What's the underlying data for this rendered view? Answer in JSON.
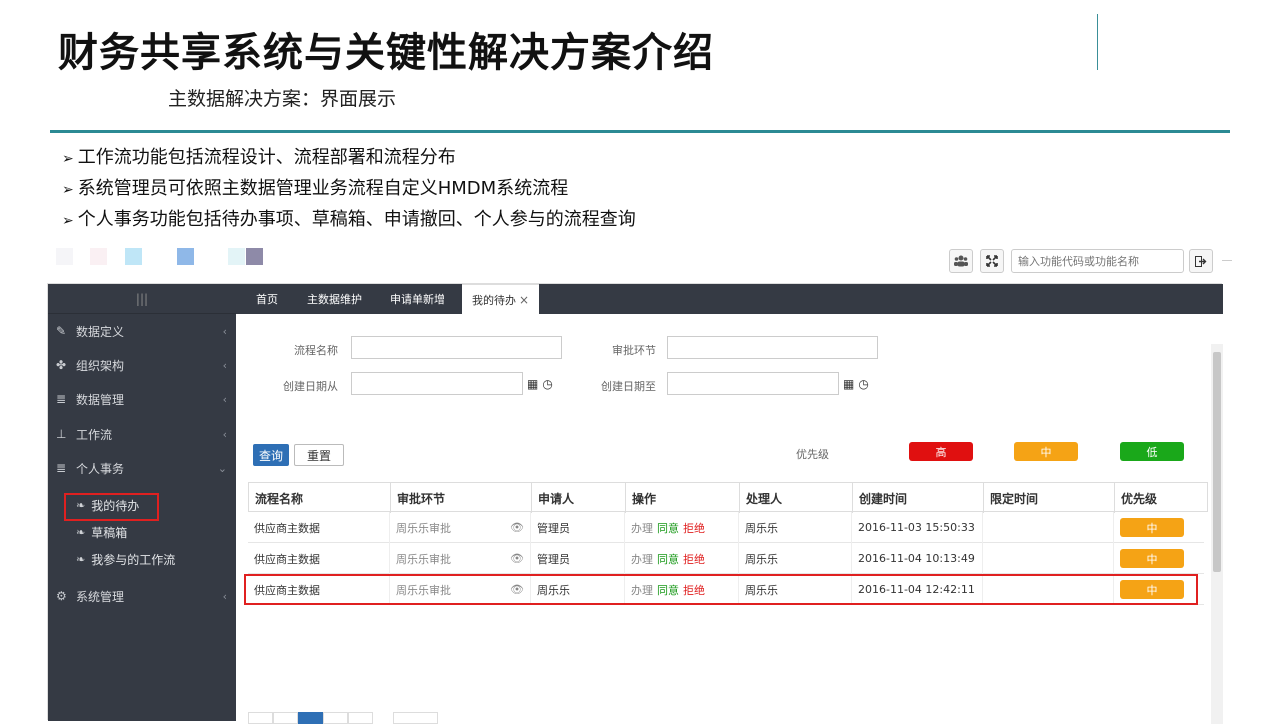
{
  "slide": {
    "title": "财务共享系统与关键性解决方案介绍",
    "subtitle": "主数据解决方案：界面展示",
    "bullets": [
      "工作流功能包括流程设计、流程部署和流程分布",
      "系统管理员可依照主数据管理业务流程自定义HMDM系统流程",
      "个人事务功能包括待办事项、草稿箱、申请撤回、个人参与的流程查询"
    ],
    "bullet_marker": "➢"
  },
  "swatches": [
    "#f5f5f8",
    "#faf0f3",
    "#bfe6f7",
    "#8fb8e8",
    "#e3f4f7",
    "#8e8aa8"
  ],
  "toolbar": {
    "search_placeholder": "输入功能代码或功能名称"
  },
  "sidebar": {
    "items": [
      {
        "label": "数据定义",
        "icon": "pencil-icon"
      },
      {
        "label": "组织架构",
        "icon": "org-icon"
      },
      {
        "label": "数据管理",
        "icon": "database-icon"
      },
      {
        "label": "工作流",
        "icon": "sitemap-icon"
      },
      {
        "label": "个人事务",
        "icon": "database-icon"
      },
      {
        "label": "系统管理",
        "icon": "gears-icon"
      }
    ],
    "sub_items": [
      {
        "label": "我的待办",
        "icon": "leaf-icon"
      },
      {
        "label": "草稿箱",
        "icon": "leaf-icon"
      },
      {
        "label": "我参与的工作流",
        "icon": "leaf-icon"
      }
    ]
  },
  "tabs": [
    {
      "label": "首页"
    },
    {
      "label": "主数据维护"
    },
    {
      "label": "申请单新增"
    },
    {
      "label": "我的待办",
      "close": "×"
    }
  ],
  "filters": {
    "process_name_label": "流程名称",
    "approval_step_label": "审批环节",
    "created_from_label": "创建日期从",
    "created_to_label": "创建日期至",
    "query_button": "查询",
    "reset_button": "重置",
    "priority_label": "优先级",
    "priorities": [
      {
        "label": "高",
        "color": "#e01010"
      },
      {
        "label": "中",
        "color": "#f5a315"
      },
      {
        "label": "低",
        "color": "#1aa81a"
      }
    ]
  },
  "table": {
    "columns": [
      "流程名称",
      "审批环节",
      "申请人",
      "操作",
      "处理人",
      "创建时间",
      "限定时间",
      "优先级"
    ],
    "rows": [
      {
        "process": "供应商主数据",
        "step": "周乐乐审批",
        "applicant": "管理员",
        "act1": "办理",
        "act2": "同意",
        "act3": "拒绝",
        "handler": "周乐乐",
        "created": "2016-11-03 15:50:33",
        "limit": "",
        "priority": "中"
      },
      {
        "process": "供应商主数据",
        "step": "周乐乐审批",
        "applicant": "管理员",
        "act1": "办理",
        "act2": "同意",
        "act3": "拒绝",
        "handler": "周乐乐",
        "created": "2016-11-04 10:13:49",
        "limit": "",
        "priority": "中"
      },
      {
        "process": "供应商主数据",
        "step": "周乐乐审批",
        "applicant": "周乐乐",
        "act1": "办理",
        "act2": "同意",
        "act3": "拒绝",
        "handler": "周乐乐",
        "created": "2016-11-04 12:42:11",
        "limit": "",
        "priority": "中"
      }
    ]
  }
}
